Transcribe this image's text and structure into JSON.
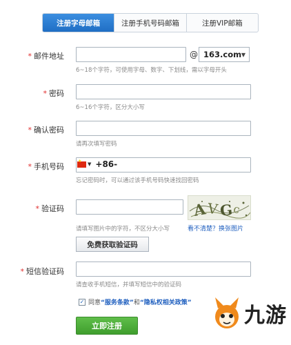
{
  "tabs": [
    {
      "label": "注册字母邮箱"
    },
    {
      "label": "注册手机号码邮箱"
    },
    {
      "label": "注册VIP邮箱"
    }
  ],
  "required_mark": "*",
  "email": {
    "label": "邮件地址",
    "value": "",
    "at": "@",
    "domain": "163.com",
    "hint": "6~18个字符，可使用字母、数字、下划线，需以字母开头"
  },
  "password": {
    "label": "密码",
    "value": "",
    "hint": "6~16个字符，区分大小写"
  },
  "confirm": {
    "label": "确认密码",
    "value": "",
    "hint": "请再次填写密码"
  },
  "phone": {
    "label": "手机号码",
    "country_code": "+86-",
    "value": "",
    "hint": "忘记密码时，可以通过该手机号码快速找回密码"
  },
  "captcha": {
    "label": "验证码",
    "value": "",
    "hint": "请填写图片中的字符，不区分大小写",
    "refresh_label": "看不清楚？换张图片",
    "sms_button": "免费获取验证码"
  },
  "sms": {
    "label": "短信验证码",
    "value": "",
    "hint": "请查收手机短信，并填写短信中的验证码"
  },
  "agreement": {
    "checked": true,
    "prefix": "同意",
    "terms": "“服务条款”",
    "and": "和",
    "privacy": "“隐私权相关政策”"
  },
  "submit_label": "立即注册",
  "watermark": {
    "text": "九游"
  },
  "colors": {
    "tab_active": "#2a7bd4",
    "required": "#e02d2d",
    "link": "#1f5fbf",
    "submit": "#4fae3b"
  }
}
